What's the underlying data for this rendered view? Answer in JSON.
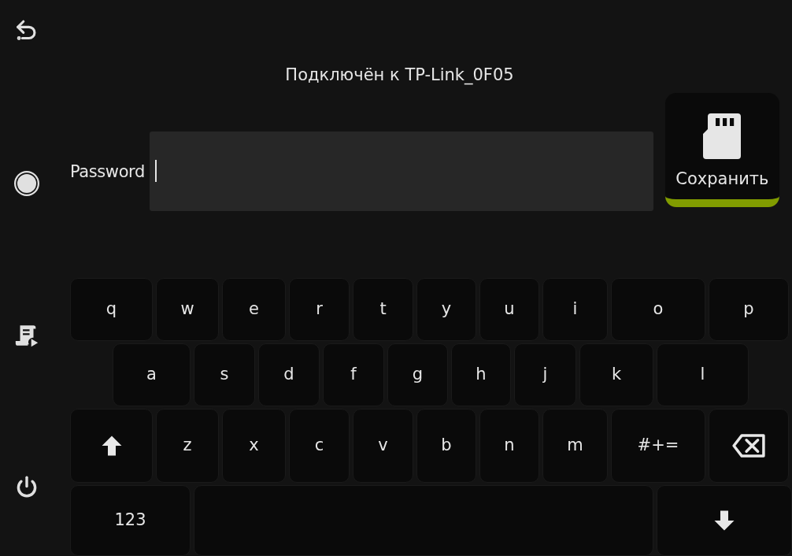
{
  "status": {
    "title": "Подключён к TP-Link_0F05"
  },
  "password_field": {
    "label": "Password",
    "focused": true
  },
  "save_button": {
    "label": "Сохранить"
  },
  "sidebar": [
    {
      "kind": "back"
    },
    {
      "kind": "status"
    },
    {
      "kind": "console"
    },
    {
      "kind": "power"
    }
  ],
  "keyboard": {
    "rows": [
      {
        "keys": [
          {
            "kind": "char",
            "label": "q"
          },
          {
            "kind": "char",
            "label": "w"
          },
          {
            "kind": "char",
            "label": "e"
          },
          {
            "kind": "char",
            "label": "r"
          },
          {
            "kind": "char",
            "label": "t"
          },
          {
            "kind": "char",
            "label": "y"
          },
          {
            "kind": "char",
            "label": "u"
          },
          {
            "kind": "char",
            "label": "i"
          },
          {
            "kind": "char",
            "label": "o"
          },
          {
            "kind": "char",
            "label": "p"
          }
        ]
      },
      {
        "keys": [
          {
            "kind": "char",
            "label": "a"
          },
          {
            "kind": "char",
            "label": "s"
          },
          {
            "kind": "char",
            "label": "d"
          },
          {
            "kind": "char",
            "label": "f"
          },
          {
            "kind": "char",
            "label": "g"
          },
          {
            "kind": "char",
            "label": "h"
          },
          {
            "kind": "char",
            "label": "j"
          },
          {
            "kind": "char",
            "label": "k"
          },
          {
            "kind": "char",
            "label": "l"
          }
        ]
      },
      {
        "keys": [
          {
            "kind": "shift"
          },
          {
            "kind": "char",
            "label": "z"
          },
          {
            "kind": "char",
            "label": "x"
          },
          {
            "kind": "char",
            "label": "c"
          },
          {
            "kind": "char",
            "label": "v"
          },
          {
            "kind": "char",
            "label": "b"
          },
          {
            "kind": "char",
            "label": "n"
          },
          {
            "kind": "char",
            "label": "m"
          },
          {
            "kind": "char",
            "label": "#+="
          },
          {
            "kind": "backspace"
          }
        ]
      },
      {
        "keys": [
          {
            "kind": "char",
            "label": "123"
          },
          {
            "kind": "space"
          },
          {
            "kind": "enter"
          }
        ]
      }
    ]
  }
}
